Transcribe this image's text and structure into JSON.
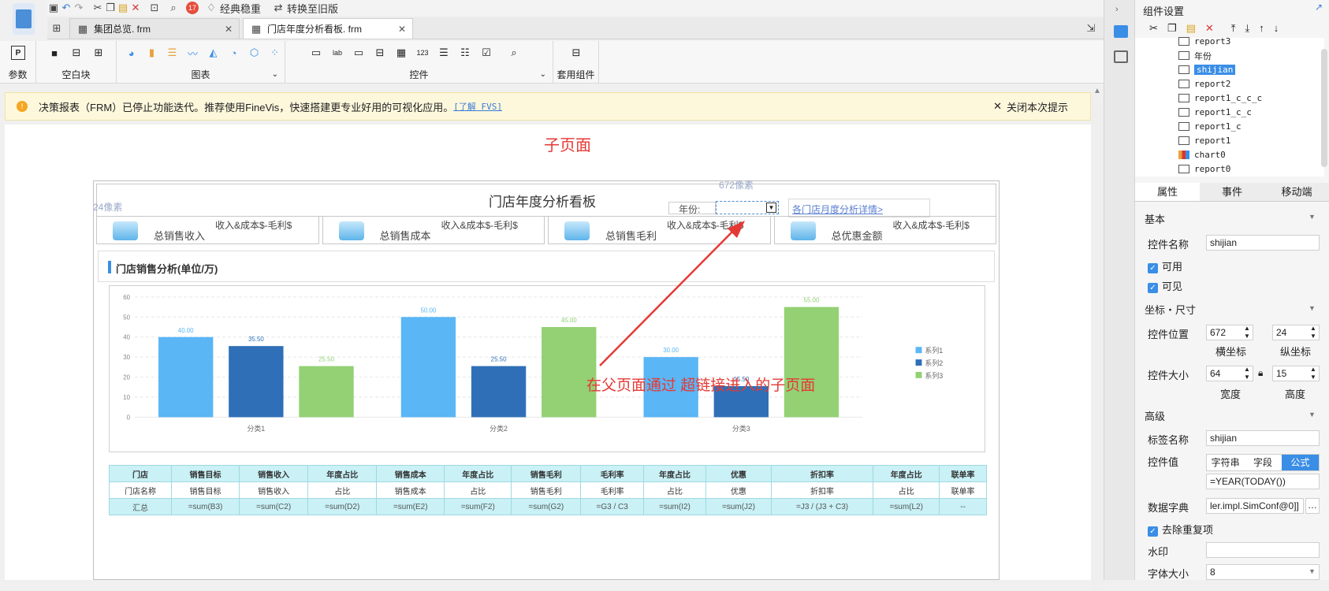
{
  "topbar": {
    "badge": "17",
    "classic_label": "经典稳重",
    "convert_label": "转换至旧版"
  },
  "tabs": [
    {
      "label": "集团总览. frm",
      "active": false
    },
    {
      "label": "门店年度分析看板. frm",
      "active": true
    }
  ],
  "ribbon": {
    "groups": [
      "参数",
      "空白块",
      "图表",
      "控件",
      "套用组件"
    ]
  },
  "notice": {
    "text": "决策报表（FRM）已停止功能迭代。推荐使用FineVis，快速搭建更专业好用的可视化应用。",
    "link": "[了解 FVS]",
    "close_label": "关闭本次提示"
  },
  "canvas": {
    "sub_title": "子页面",
    "dashboard_title": "门店年度分析看板",
    "px_top": "672像素",
    "px_left": "24像素",
    "year_label": "年份:",
    "link_text": "各门店月度分析详情>",
    "annotation": "在父页面通过 超链接进入的子页面",
    "kpis": [
      {
        "name": "总销售收入",
        "desc": "收入&成本$-毛利$"
      },
      {
        "name": "总销售成本",
        "desc": "收入&成本$-毛利$"
      },
      {
        "name": "总销售毛利",
        "desc": "收入&成本$-毛利$"
      },
      {
        "name": "总优惠金额",
        "desc": "收入&成本$-毛利$"
      }
    ],
    "section_title": "门店销售分析(单位/万)"
  },
  "chart_data": {
    "type": "bar",
    "categories": [
      "分类1",
      "分类2",
      "分类3"
    ],
    "ylim": [
      0,
      60
    ],
    "yticks": [
      "0",
      "10",
      "20",
      "30",
      "40",
      "50",
      "60"
    ],
    "series": [
      {
        "name": "系列1",
        "values": [
          40,
          50,
          30
        ],
        "labels": [
          "40.00",
          "50.00",
          "30.00"
        ]
      },
      {
        "name": "系列2",
        "values": [
          35.5,
          25.5,
          15.5
        ],
        "labels": [
          "35.50",
          "25.50",
          "15.50"
        ]
      },
      {
        "name": "系列3",
        "values": [
          25.5,
          45,
          55
        ],
        "labels": [
          "25.50",
          "45.00",
          "55.00"
        ]
      }
    ],
    "colors": [
      "#5ab6f5",
      "#2f6fb7",
      "#93d174"
    ]
  },
  "table": {
    "headers": [
      "门店",
      "销售目标",
      "销售收入",
      "年度占比",
      "销售成本",
      "年度占比",
      "销售毛利",
      "毛利率",
      "年度占比",
      "优惠",
      "折扣率",
      "年度占比",
      "联单率"
    ],
    "row": [
      "门店名称",
      "销售目标",
      "销售收入",
      "占比",
      "销售成本",
      "占比",
      "销售毛利",
      "毛利率",
      "占比",
      "优惠",
      "折扣率",
      "占比",
      "联单率"
    ],
    "summary": [
      "汇总",
      "=sum(B3)",
      "=sum(C2)",
      "=sum(D2)",
      "=sum(E2)",
      "=sum(F2)",
      "=sum(G2)",
      "=G3 / C3",
      "=sum(I2)",
      "=sum(J2)",
      "=J3 / (J3 + C3)",
      "=sum(L2)",
      "--"
    ]
  },
  "panel": {
    "title": "组件设置",
    "tree": [
      "report3",
      "年份",
      "shijian",
      "report2",
      "report1_c_c_c",
      "report1_c_c",
      "report1_c",
      "report1",
      "chart0",
      "report0"
    ],
    "tabs": [
      "属性",
      "事件",
      "移动端"
    ],
    "basic": "基本",
    "name_label": "控件名称",
    "name_value": "shijian",
    "enabled": "可用",
    "visible": "可见",
    "coord_section": "坐标・尺寸",
    "pos_label": "控件位置",
    "pos_x": "672",
    "pos_y": "24",
    "x_label": "横坐标",
    "y_label": "纵坐标",
    "size_label": "控件大小",
    "width": "64",
    "height": "15",
    "w_label": "宽度",
    "h_label": "高度",
    "advanced": "高级",
    "tag_label": "标签名称",
    "tag_value": "shijian",
    "value_label": "控件值",
    "value_tabs": [
      "字符串",
      "字段",
      "公式"
    ],
    "formula": "=YEAR(TODAY())",
    "dict_label": "数据字典",
    "dict_value": "ler.impl.SimConf@0]]",
    "dedupe": "去除重复项",
    "watermark_label": "水印",
    "font_size_label": "字体大小",
    "font_size_value": "8"
  }
}
